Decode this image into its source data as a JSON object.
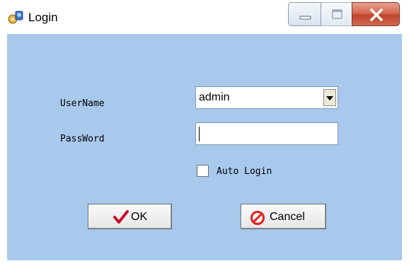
{
  "window": {
    "title": "Login",
    "controls": {
      "minimize_icon": "minimize-icon",
      "maximize_icon": "maximize-icon",
      "close_icon": "close-icon"
    }
  },
  "form": {
    "username": {
      "label": "UserName",
      "selected_value": "admin"
    },
    "password": {
      "label": "PassWord",
      "value": ""
    },
    "auto_login": {
      "label": "Auto Login",
      "checked": false
    }
  },
  "buttons": {
    "ok": {
      "label": "OK",
      "icon": "checkmark-icon"
    },
    "cancel": {
      "label": "Cancel",
      "icon": "prohibited-icon"
    }
  },
  "colors": {
    "client_background": "#a8c8ec",
    "close_button": "#c0442c",
    "ok_check": "#c8102e",
    "cancel_symbol": "#e02020"
  }
}
